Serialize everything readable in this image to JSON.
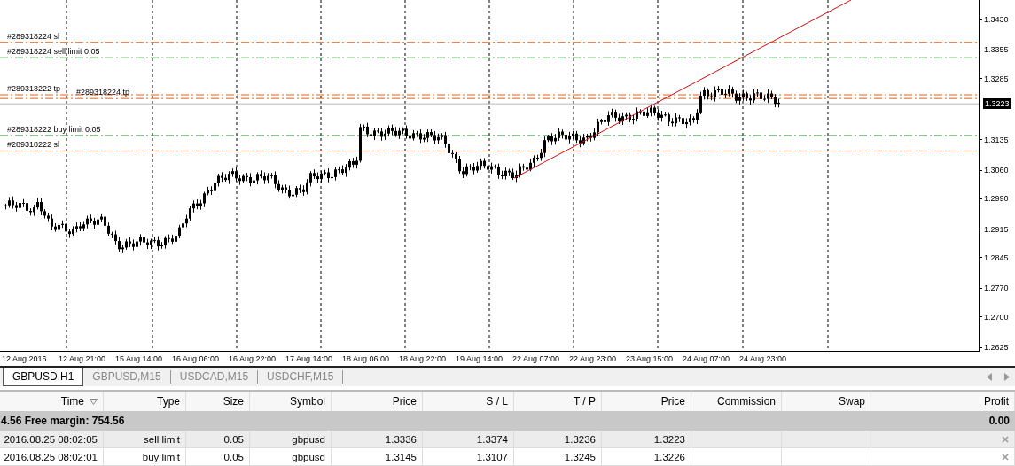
{
  "chart": {
    "order_lines": [
      {
        "label": "#289318224 sl",
        "kind": "sl"
      },
      {
        "label": "#289318224 sell limit 0.05",
        "kind": "limit"
      },
      {
        "label": "#289318222 tp",
        "kind": "tp"
      },
      {
        "label": "#289318224 tp",
        "kind": "tp"
      },
      {
        "label": "#289318222 buy limit 0.05",
        "kind": "limit"
      },
      {
        "label": "#289318222 sl",
        "kind": "sl"
      }
    ],
    "current_price": "1.3223",
    "price_ticks": [
      "1.3430",
      "1.3355",
      "1.3285",
      "1.3135",
      "1.3060",
      "1.2990",
      "1.2915",
      "1.2845",
      "1.2770",
      "1.2700",
      "1.2625"
    ],
    "time_labels": [
      "12 Aug 2016",
      "12 Aug 21:00",
      "15 Aug 14:00",
      "16 Aug 06:00",
      "16 Aug 22:00",
      "17 Aug 14:00",
      "18 Aug 06:00",
      "18 Aug 22:00",
      "19 Aug 14:00",
      "22 Aug 07:00",
      "22 Aug 23:00",
      "23 Aug 15:00",
      "24 Aug 07:00",
      "24 Aug 23:00"
    ]
  },
  "tabs": [
    {
      "label": "GBPUSD,H1",
      "selected": true
    },
    {
      "label": "GBPUSD,M15",
      "selected": false
    },
    {
      "label": "USDCAD,M15",
      "selected": false
    },
    {
      "label": "USDCHF,M15",
      "selected": false
    }
  ],
  "table": {
    "columns": [
      "Time",
      "Type",
      "Size",
      "Symbol",
      "Price",
      "S / L",
      "T / P",
      "Price",
      "Commission",
      "Swap",
      "Profit"
    ],
    "summary": {
      "text": "4.56  Free margin: 754.56",
      "profit": "0.00"
    },
    "rows": [
      {
        "selected": true,
        "cells": [
          "2016.08.25 08:02:05",
          "sell limit",
          "0.05",
          "gbpusd",
          "1.3336",
          "1.3374",
          "1.3236",
          "1.3223",
          "",
          "",
          ""
        ]
      },
      {
        "selected": false,
        "cells": [
          "2016.08.25 08:02:01",
          "buy limit",
          "0.05",
          "gbpusd",
          "1.3145",
          "1.3107",
          "1.3245",
          "1.3226",
          "",
          "",
          ""
        ]
      }
    ]
  }
}
